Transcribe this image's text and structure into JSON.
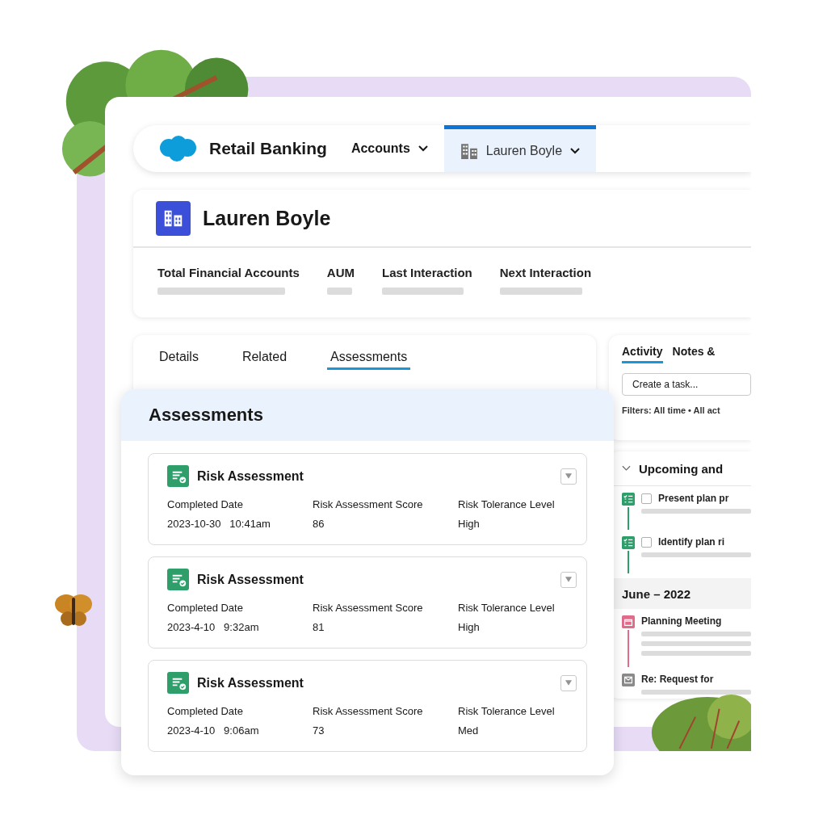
{
  "nav": {
    "app_name": "Retail Banking",
    "tabs": [
      {
        "label": "Accounts",
        "selected": false,
        "kind": "menu"
      },
      {
        "label": "Lauren Boyle",
        "selected": true,
        "kind": "record"
      }
    ]
  },
  "record": {
    "title": "Lauren Boyle",
    "fields": [
      "Total Financial Accounts",
      "AUM",
      "Last Interaction",
      "Next Interaction"
    ]
  },
  "detail_tabs": [
    {
      "label": "Details",
      "selected": false
    },
    {
      "label": "Related",
      "selected": false
    },
    {
      "label": "Assessments",
      "selected": true
    }
  ],
  "assessments": {
    "title": "Assessments",
    "cards": [
      {
        "title": "Risk Assessment",
        "fields": [
          {
            "label": "Completed Date",
            "value": "2023-10-30   10:41am"
          },
          {
            "label": "Risk Assessment Score",
            "value": "86"
          },
          {
            "label": "Risk Tolerance Level",
            "value": "High"
          }
        ]
      },
      {
        "title": "Risk Assessment",
        "fields": [
          {
            "label": "Completed Date",
            "value": "2023-4-10   9:32am"
          },
          {
            "label": "Risk Assessment Score",
            "value": "81"
          },
          {
            "label": "Risk Tolerance Level",
            "value": "High"
          }
        ]
      },
      {
        "title": "Risk Assessment",
        "fields": [
          {
            "label": "Completed Date",
            "value": "2023-4-10   9:06am"
          },
          {
            "label": "Risk Assessment Score",
            "value": "73"
          },
          {
            "label": "Risk Tolerance Level",
            "value": "Med"
          }
        ]
      }
    ]
  },
  "activity": {
    "tabs": [
      {
        "label": "Activity",
        "selected": true
      },
      {
        "label": "Notes &",
        "selected": false
      }
    ],
    "task_field": {
      "placeholder": "Create a task..."
    },
    "filters": "Filters: All time • All act",
    "upcoming": {
      "title": "Upcoming and",
      "expanded": true,
      "items": [
        {
          "kind": "task",
          "title": "Present plan pr",
          "checked": false
        },
        {
          "kind": "task",
          "title": "Identify plan ri",
          "checked": false
        }
      ]
    },
    "month": "June – 2022",
    "month_items": [
      {
        "kind": "event",
        "title": "Planning Meeting"
      },
      {
        "kind": "email",
        "title": "Re: Request for"
      }
    ]
  }
}
